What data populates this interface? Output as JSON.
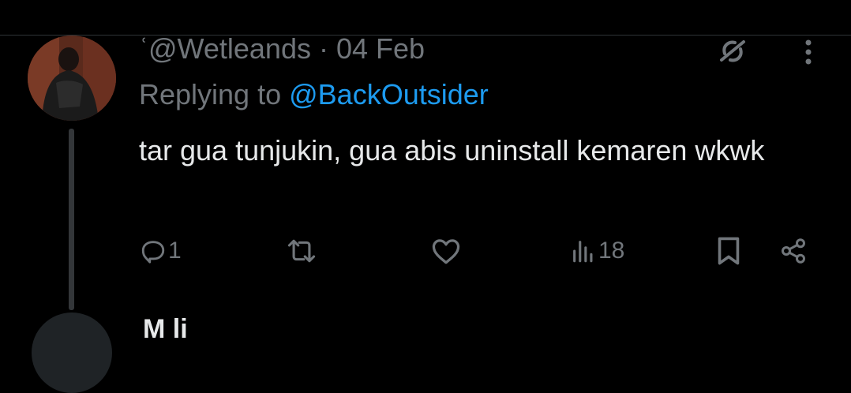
{
  "tweet": {
    "handle_line": "ʿ@Wetleands · 04 Feb",
    "replying_prefix": "Replying to ",
    "replying_handle": "@BackOutsider",
    "text": "tar gua tunjukin, gua abis uninstall kemaren wkwk",
    "stats": {
      "replies": "1",
      "views": "18"
    }
  },
  "next_tweet": {
    "name_partial": "M   li"
  },
  "colors": {
    "background": "#000000",
    "text_primary": "#e7e9ea",
    "text_secondary": "#71767b",
    "accent": "#1d9bf0",
    "divider": "#2f3336"
  },
  "icons": [
    "grok-icon",
    "more-icon",
    "reply-icon",
    "retweet-icon",
    "like-icon",
    "views-icon",
    "bookmark-icon",
    "share-icon"
  ]
}
